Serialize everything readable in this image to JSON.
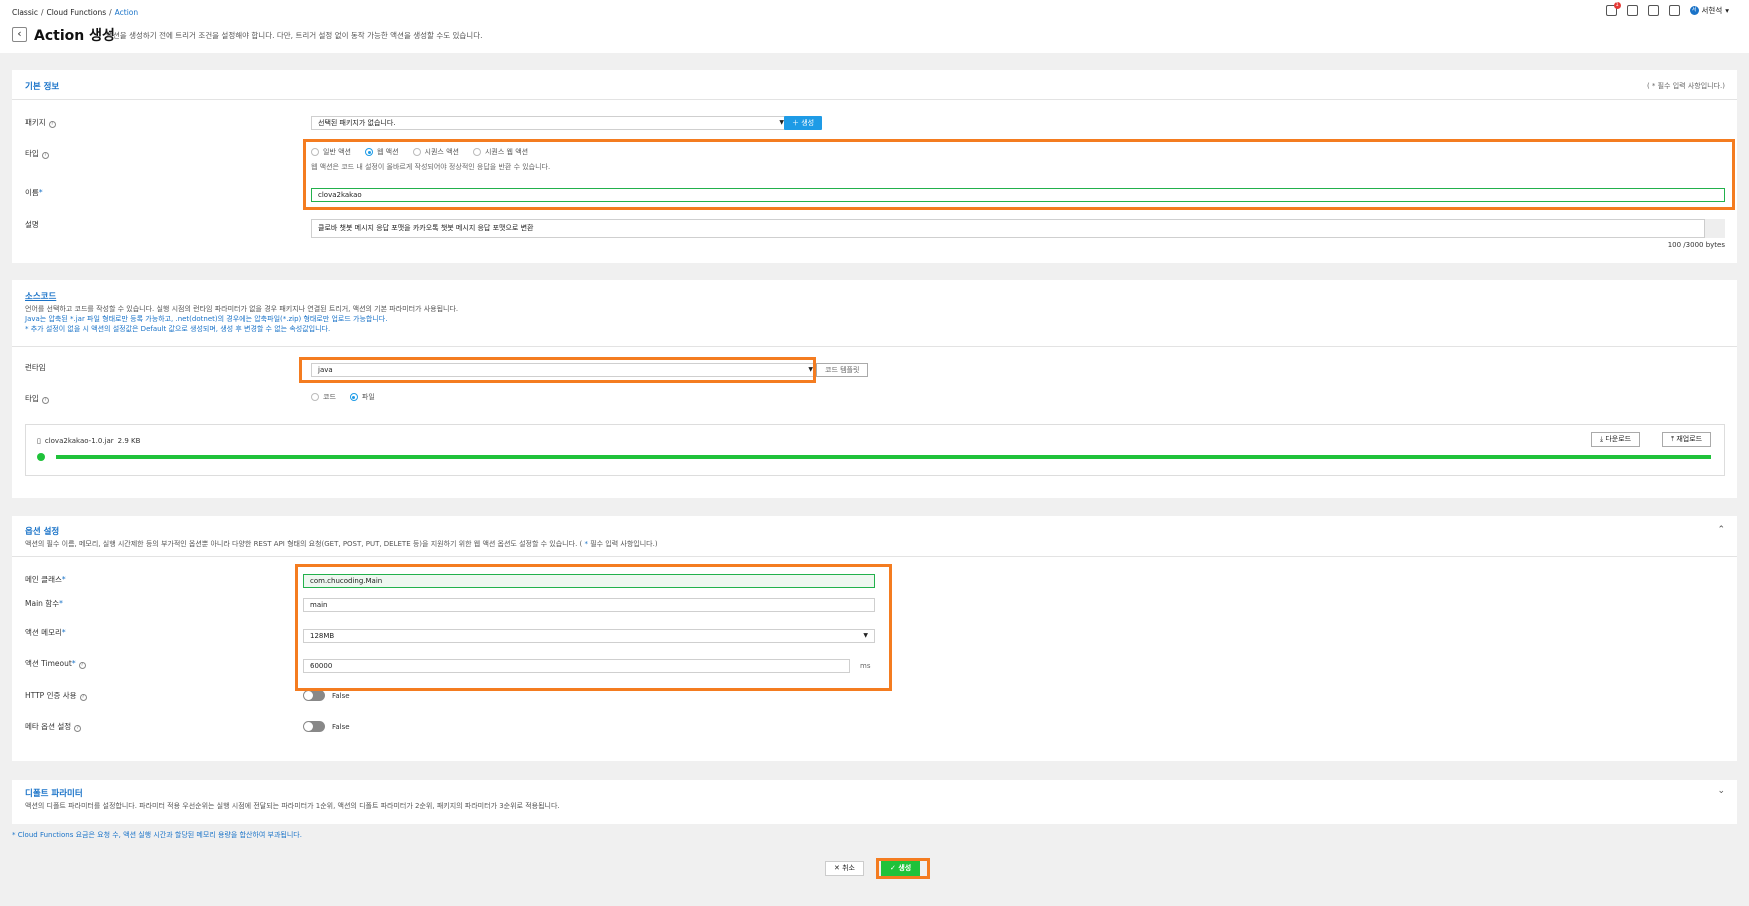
{
  "breadcrumb": {
    "items": [
      "Classic",
      "Cloud Functions",
      "Action"
    ]
  },
  "header": {
    "title": "Action 생성",
    "description": "액션을 생성하기 전에 트리거 조건을 설정해야 합니다. 다만, 트리거 설정 없이 동작 가능한 액션을 생성할 수도 있습니다.",
    "user_name": "서현석",
    "user_initial": "서",
    "notification_count": "1"
  },
  "basic": {
    "title": "기본 정보",
    "required_note": "( * 필수 입력 사항입니다.)",
    "package_label": "패키지",
    "package_value": "선택된 패키지가 없습니다.",
    "create_label": "생성",
    "type_label": "타입",
    "type_options": [
      "일반 액션",
      "웹 액션",
      "시퀀스 액션",
      "시퀀스 웹 액션"
    ],
    "type_selected": 1,
    "type_helper": "웹 액션은 코드 내 설정이 올바르게 작성되어야 정상적인 응답을 반환 수 있습니다.",
    "name_label": "이름",
    "name_value": "clova2kakao",
    "desc_label": "설명",
    "desc_value": "클로바 챗봇 메시지 응답 포맷을 카카오톡 챗봇 메시지 응답 포맷으로 변환",
    "byte_count": "100 /3000 bytes"
  },
  "source": {
    "title": "소스코드",
    "line1": "언어를 선택하고 코드를 작성할 수 있습니다. 실행 시점의 런타임 파라미터가 없을 경우 패키지나 연결된 트리거, 액션의 기본 파라미터가 사용됩니다.",
    "line2": "Java는 압축된 *.jar 파일 형태로만 등록 가능하고, .net(dotnet)의 경우에는 압축파일(*.zip) 형태로만 업로드 가능합니다.",
    "line3": "* 추가 설정이 없을 시 액션의 설정값은 Default 값으로 생성되며, 생성 후 변경할 수 없는 속성값입니다.",
    "runtime_label": "런타임",
    "runtime_value": "java",
    "template_label": "코드 템플릿",
    "type_label": "타입",
    "type_options": [
      "코드",
      "파일"
    ],
    "type_selected": 1,
    "file_name": "clova2kakao-1.0.jar",
    "file_size": "2.9 KB",
    "download_label": "다운로드",
    "reupload_label": "재업로드",
    "upload_progress": 1.0
  },
  "options": {
    "title": "옵션 설정",
    "desc_prefix": "액션의 필수 이름, 메모리, 실행 시간제한 등의 부가적인 옵션뿐 아니라 다양한 REST API 형태의 요청(GET, POST, PUT, DELETE 등)을 지원하기 위한 웹 액션 옵션도 설정할 수 있습니다. (",
    "desc_star": " * ",
    "desc_suffix": "필수 입력 사항입니다.)",
    "main_class_label": "메인 클래스",
    "main_class_value": "com.chucoding.Main",
    "main_method_label": "Main 함수",
    "main_method_value": "main",
    "memory_label": "액션 메모리",
    "memory_value": "128MB",
    "timeout_label": "액션 Timeout",
    "timeout_value": "60000",
    "timeout_unit": "ms",
    "http_label": "HTTP 인증 사용",
    "http_value": "False",
    "meta_label": "메타 옵션 설정",
    "meta_value": "False"
  },
  "params": {
    "title": "디폴트 파라미터",
    "desc": "액션의 디폴트 파라미터를 설정합니다. 파라미터 적용 우선순위는 실행 시점에 전달되는 파라미터가 1순위, 액션의 디폴트 파라미터가 2순위, 패키지의 파라미터가 3순위로 적용됩니다."
  },
  "footer": {
    "note": "* Cloud Functions 요금은 요청 수, 액션 실행 시간과 할당된 메모리 용량을 합산하여 부과됩니다.",
    "cancel_label": "취소",
    "create_label": "생성"
  },
  "colors": {
    "accent": "#1a73c8",
    "highlight": "#f47c20",
    "success": "#1fc23a",
    "button": "#1e9be6"
  }
}
